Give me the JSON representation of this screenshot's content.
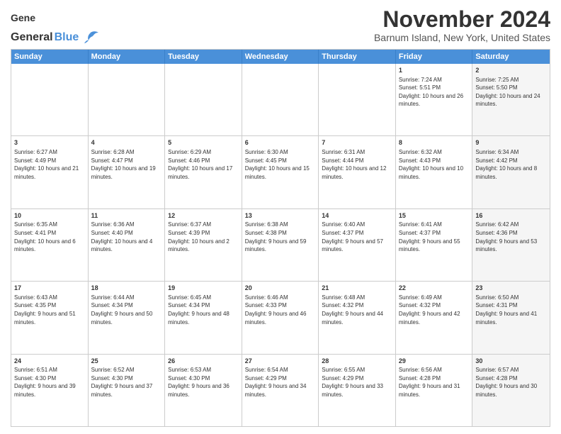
{
  "header": {
    "logo_general": "General",
    "logo_blue": "Blue",
    "month_title": "November 2024",
    "location": "Barnum Island, New York, United States"
  },
  "weekdays": [
    "Sunday",
    "Monday",
    "Tuesday",
    "Wednesday",
    "Thursday",
    "Friday",
    "Saturday"
  ],
  "rows": [
    [
      {
        "day": "",
        "text": "",
        "shaded": false
      },
      {
        "day": "",
        "text": "",
        "shaded": false
      },
      {
        "day": "",
        "text": "",
        "shaded": false
      },
      {
        "day": "",
        "text": "",
        "shaded": false
      },
      {
        "day": "",
        "text": "",
        "shaded": false
      },
      {
        "day": "1",
        "text": "Sunrise: 7:24 AM\nSunset: 5:51 PM\nDaylight: 10 hours and 26 minutes.",
        "shaded": false
      },
      {
        "day": "2",
        "text": "Sunrise: 7:25 AM\nSunset: 5:50 PM\nDaylight: 10 hours and 24 minutes.",
        "shaded": true
      }
    ],
    [
      {
        "day": "3",
        "text": "Sunrise: 6:27 AM\nSunset: 4:49 PM\nDaylight: 10 hours and 21 minutes.",
        "shaded": false
      },
      {
        "day": "4",
        "text": "Sunrise: 6:28 AM\nSunset: 4:47 PM\nDaylight: 10 hours and 19 minutes.",
        "shaded": false
      },
      {
        "day": "5",
        "text": "Sunrise: 6:29 AM\nSunset: 4:46 PM\nDaylight: 10 hours and 17 minutes.",
        "shaded": false
      },
      {
        "day": "6",
        "text": "Sunrise: 6:30 AM\nSunset: 4:45 PM\nDaylight: 10 hours and 15 minutes.",
        "shaded": false
      },
      {
        "day": "7",
        "text": "Sunrise: 6:31 AM\nSunset: 4:44 PM\nDaylight: 10 hours and 12 minutes.",
        "shaded": false
      },
      {
        "day": "8",
        "text": "Sunrise: 6:32 AM\nSunset: 4:43 PM\nDaylight: 10 hours and 10 minutes.",
        "shaded": false
      },
      {
        "day": "9",
        "text": "Sunrise: 6:34 AM\nSunset: 4:42 PM\nDaylight: 10 hours and 8 minutes.",
        "shaded": true
      }
    ],
    [
      {
        "day": "10",
        "text": "Sunrise: 6:35 AM\nSunset: 4:41 PM\nDaylight: 10 hours and 6 minutes.",
        "shaded": false
      },
      {
        "day": "11",
        "text": "Sunrise: 6:36 AM\nSunset: 4:40 PM\nDaylight: 10 hours and 4 minutes.",
        "shaded": false
      },
      {
        "day": "12",
        "text": "Sunrise: 6:37 AM\nSunset: 4:39 PM\nDaylight: 10 hours and 2 minutes.",
        "shaded": false
      },
      {
        "day": "13",
        "text": "Sunrise: 6:38 AM\nSunset: 4:38 PM\nDaylight: 9 hours and 59 minutes.",
        "shaded": false
      },
      {
        "day": "14",
        "text": "Sunrise: 6:40 AM\nSunset: 4:37 PM\nDaylight: 9 hours and 57 minutes.",
        "shaded": false
      },
      {
        "day": "15",
        "text": "Sunrise: 6:41 AM\nSunset: 4:37 PM\nDaylight: 9 hours and 55 minutes.",
        "shaded": false
      },
      {
        "day": "16",
        "text": "Sunrise: 6:42 AM\nSunset: 4:36 PM\nDaylight: 9 hours and 53 minutes.",
        "shaded": true
      }
    ],
    [
      {
        "day": "17",
        "text": "Sunrise: 6:43 AM\nSunset: 4:35 PM\nDaylight: 9 hours and 51 minutes.",
        "shaded": false
      },
      {
        "day": "18",
        "text": "Sunrise: 6:44 AM\nSunset: 4:34 PM\nDaylight: 9 hours and 50 minutes.",
        "shaded": false
      },
      {
        "day": "19",
        "text": "Sunrise: 6:45 AM\nSunset: 4:34 PM\nDaylight: 9 hours and 48 minutes.",
        "shaded": false
      },
      {
        "day": "20",
        "text": "Sunrise: 6:46 AM\nSunset: 4:33 PM\nDaylight: 9 hours and 46 minutes.",
        "shaded": false
      },
      {
        "day": "21",
        "text": "Sunrise: 6:48 AM\nSunset: 4:32 PM\nDaylight: 9 hours and 44 minutes.",
        "shaded": false
      },
      {
        "day": "22",
        "text": "Sunrise: 6:49 AM\nSunset: 4:32 PM\nDaylight: 9 hours and 42 minutes.",
        "shaded": false
      },
      {
        "day": "23",
        "text": "Sunrise: 6:50 AM\nSunset: 4:31 PM\nDaylight: 9 hours and 41 minutes.",
        "shaded": true
      }
    ],
    [
      {
        "day": "24",
        "text": "Sunrise: 6:51 AM\nSunset: 4:30 PM\nDaylight: 9 hours and 39 minutes.",
        "shaded": false
      },
      {
        "day": "25",
        "text": "Sunrise: 6:52 AM\nSunset: 4:30 PM\nDaylight: 9 hours and 37 minutes.",
        "shaded": false
      },
      {
        "day": "26",
        "text": "Sunrise: 6:53 AM\nSunset: 4:30 PM\nDaylight: 9 hours and 36 minutes.",
        "shaded": false
      },
      {
        "day": "27",
        "text": "Sunrise: 6:54 AM\nSunset: 4:29 PM\nDaylight: 9 hours and 34 minutes.",
        "shaded": false
      },
      {
        "day": "28",
        "text": "Sunrise: 6:55 AM\nSunset: 4:29 PM\nDaylight: 9 hours and 33 minutes.",
        "shaded": false
      },
      {
        "day": "29",
        "text": "Sunrise: 6:56 AM\nSunset: 4:28 PM\nDaylight: 9 hours and 31 minutes.",
        "shaded": false
      },
      {
        "day": "30",
        "text": "Sunrise: 6:57 AM\nSunset: 4:28 PM\nDaylight: 9 hours and 30 minutes.",
        "shaded": true
      }
    ]
  ]
}
